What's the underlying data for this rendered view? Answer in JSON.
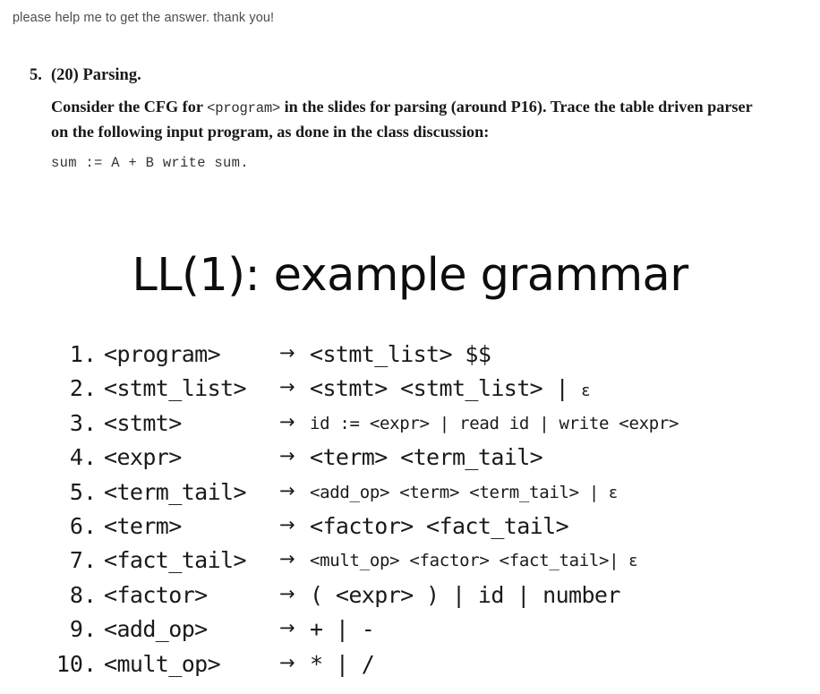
{
  "user_comment": "please help me to get the answer. thank you!",
  "problem": {
    "number": "5.",
    "title": "(20) Parsing.",
    "body_part1": "Consider the CFG for ",
    "body_mono": "<program>",
    "body_part2": " in the slides for parsing (around P16). Trace the table driven parser on the following input program, as done in the class discussion:",
    "code": "sum := A + B write sum."
  },
  "slide": {
    "title": "LL(1): example grammar",
    "arrow": "→",
    "rules": [
      {
        "num": "1.",
        "lhs": "<program>",
        "rhs": "<stmt_list> $$",
        "rhs_small": false,
        "epsilon": false
      },
      {
        "num": "2.",
        "lhs": "<stmt_list>",
        "rhs": "<stmt> <stmt_list> | ",
        "rhs_small": false,
        "epsilon": true
      },
      {
        "num": "3.",
        "lhs": "<stmt>",
        "rhs": "id := <expr> | read id  | write <expr>",
        "rhs_small": true,
        "epsilon": false
      },
      {
        "num": "4.",
        "lhs": "<expr>",
        "rhs": "<term> <term_tail>",
        "rhs_small": false,
        "epsilon": false
      },
      {
        "num": "5.",
        "lhs": "<term_tail>",
        "rhs": "<add_op> <term> <term_tail> | ",
        "rhs_small": true,
        "epsilon": true
      },
      {
        "num": "6.",
        "lhs": "<term>",
        "rhs": "<factor> <fact_tail>",
        "rhs_small": false,
        "epsilon": false
      },
      {
        "num": "7.",
        "lhs": "<fact_tail>",
        "rhs": "<mult_op> <factor> <fact_tail>| ",
        "rhs_small": true,
        "epsilon": true
      },
      {
        "num": "8.",
        "lhs": "<factor>",
        "rhs": "( <expr> ) | id | number",
        "rhs_small": false,
        "epsilon": false
      },
      {
        "num": "9.",
        "lhs": "<add_op>",
        "rhs": "+ | -",
        "rhs_small": false,
        "epsilon": false
      },
      {
        "num": "10.",
        "lhs": "<mult_op>",
        "rhs": "* | /",
        "rhs_small": false,
        "epsilon": false
      }
    ],
    "epsilon_symbol": "ε"
  }
}
